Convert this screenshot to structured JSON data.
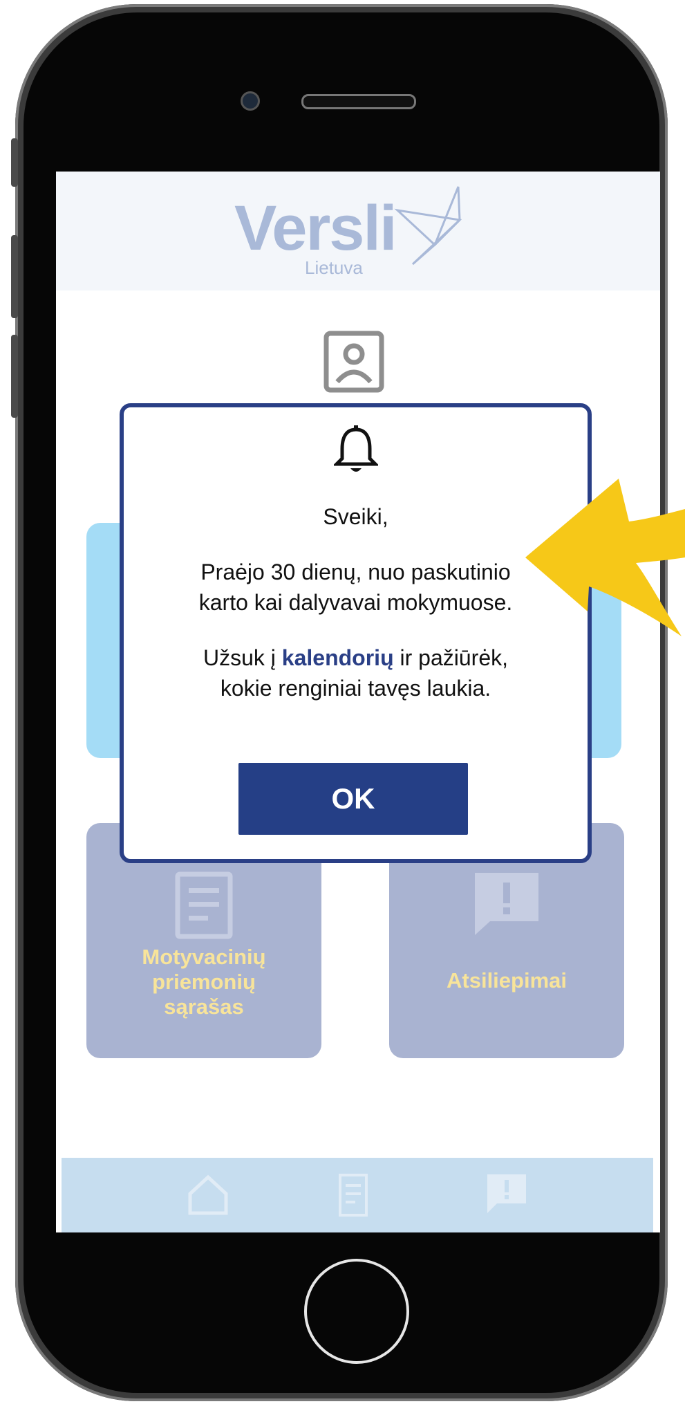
{
  "brand": {
    "name": "Versli",
    "subtitle": "Lietuva"
  },
  "tiles": [
    {
      "label_lines": [
        "Motyvacinių",
        "priemonių",
        "sąrašas"
      ],
      "icon": "document-icon"
    },
    {
      "label": "Atsiliepimai",
      "icon": "feedback-icon"
    }
  ],
  "modal": {
    "icon": "bell-icon",
    "greeting": "Sveiki,",
    "line1": "Praėjo 30 dienų, nuo paskutinio",
    "line2": "karto kai dalyvavai mokymuose.",
    "line3_prefix": "Užsuk į ",
    "line3_link": "kalendorių",
    "line3_suffix": " ir pažiūrėk,",
    "line4": "kokie renginiai tavęs laukia.",
    "ok_label": "OK"
  },
  "bottom_nav": [
    {
      "icon": "home-icon"
    },
    {
      "icon": "document-icon"
    },
    {
      "icon": "feedback-icon"
    }
  ],
  "colors": {
    "modal_border": "#2a3f86",
    "ok_button": "#253f86",
    "tile_blue": "#a4dcf6",
    "tile_grey": "#a9b3d1",
    "tile_label": "#f8e49a",
    "arrow": "#f6c818",
    "nav_bar": "#c6ddef"
  }
}
